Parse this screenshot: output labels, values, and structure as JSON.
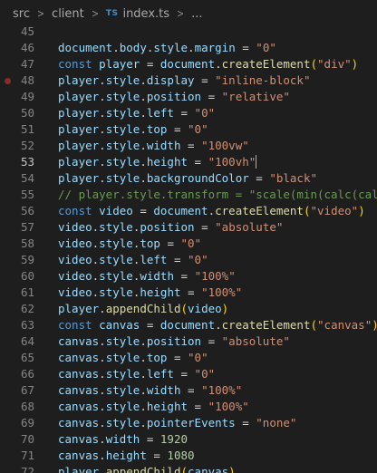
{
  "breadcrumb": {
    "items": [
      "src",
      "client",
      "index.ts",
      "..."
    ],
    "ts_badge": "TS"
  },
  "editor": {
    "language": "typescript",
    "current_line": 53,
    "breakpoint_lines": [
      48
    ],
    "lines": [
      {
        "n": 45,
        "tokens": []
      },
      {
        "n": 46,
        "tokens": [
          [
            "t-var",
            "document"
          ],
          [
            "t-op",
            "."
          ],
          [
            "t-var",
            "body"
          ],
          [
            "t-op",
            "."
          ],
          [
            "t-var",
            "style"
          ],
          [
            "t-op",
            "."
          ],
          [
            "t-var",
            "margin"
          ],
          [
            "t-op",
            " = "
          ],
          [
            "t-str",
            "\"0\""
          ]
        ]
      },
      {
        "n": 47,
        "tokens": [
          [
            "t-kw",
            "const "
          ],
          [
            "t-var",
            "player"
          ],
          [
            "t-op",
            " = "
          ],
          [
            "t-var",
            "document"
          ],
          [
            "t-op",
            "."
          ],
          [
            "t-fn",
            "createElement"
          ],
          [
            "t-p1",
            "("
          ],
          [
            "t-str",
            "\"div\""
          ],
          [
            "t-p1",
            ")"
          ]
        ]
      },
      {
        "n": 48,
        "tokens": [
          [
            "t-var",
            "player"
          ],
          [
            "t-op",
            "."
          ],
          [
            "t-var",
            "style"
          ],
          [
            "t-op",
            "."
          ],
          [
            "t-var",
            "display"
          ],
          [
            "t-op",
            " = "
          ],
          [
            "t-str",
            "\"inline-block\""
          ]
        ]
      },
      {
        "n": 49,
        "tokens": [
          [
            "t-var",
            "player"
          ],
          [
            "t-op",
            "."
          ],
          [
            "t-var",
            "style"
          ],
          [
            "t-op",
            "."
          ],
          [
            "t-var",
            "position"
          ],
          [
            "t-op",
            " = "
          ],
          [
            "t-str",
            "\"relative\""
          ]
        ]
      },
      {
        "n": 50,
        "tokens": [
          [
            "t-var",
            "player"
          ],
          [
            "t-op",
            "."
          ],
          [
            "t-var",
            "style"
          ],
          [
            "t-op",
            "."
          ],
          [
            "t-var",
            "left"
          ],
          [
            "t-op",
            " = "
          ],
          [
            "t-str",
            "\"0\""
          ]
        ]
      },
      {
        "n": 51,
        "tokens": [
          [
            "t-var",
            "player"
          ],
          [
            "t-op",
            "."
          ],
          [
            "t-var",
            "style"
          ],
          [
            "t-op",
            "."
          ],
          [
            "t-var",
            "top"
          ],
          [
            "t-op",
            " = "
          ],
          [
            "t-str",
            "\"0\""
          ]
        ]
      },
      {
        "n": 52,
        "tokens": [
          [
            "t-var",
            "player"
          ],
          [
            "t-op",
            "."
          ],
          [
            "t-var",
            "style"
          ],
          [
            "t-op",
            "."
          ],
          [
            "t-var",
            "width"
          ],
          [
            "t-op",
            " = "
          ],
          [
            "t-str",
            "\"100vw\""
          ]
        ]
      },
      {
        "n": 53,
        "tokens": [
          [
            "t-var",
            "player"
          ],
          [
            "t-op",
            "."
          ],
          [
            "t-var",
            "style"
          ],
          [
            "t-op",
            "."
          ],
          [
            "t-var",
            "height"
          ],
          [
            "t-op",
            " = "
          ],
          [
            "t-str",
            "\"100vh\""
          ]
        ],
        "cursor": true
      },
      {
        "n": 54,
        "tokens": [
          [
            "t-var",
            "player"
          ],
          [
            "t-op",
            "."
          ],
          [
            "t-var",
            "style"
          ],
          [
            "t-op",
            "."
          ],
          [
            "t-var",
            "backgroundColor"
          ],
          [
            "t-op",
            " = "
          ],
          [
            "t-str",
            "\"black\""
          ]
        ]
      },
      {
        "n": 55,
        "tokens": [
          [
            "t-com",
            "// player.style.transform = \"scale(min(calc(calc("
          ]
        ]
      },
      {
        "n": 56,
        "tokens": [
          [
            "t-kw",
            "const "
          ],
          [
            "t-var",
            "video"
          ],
          [
            "t-op",
            " = "
          ],
          [
            "t-var",
            "document"
          ],
          [
            "t-op",
            "."
          ],
          [
            "t-fn",
            "createElement"
          ],
          [
            "t-p1",
            "("
          ],
          [
            "t-str",
            "\"video\""
          ],
          [
            "t-p1",
            ")"
          ]
        ]
      },
      {
        "n": 57,
        "tokens": [
          [
            "t-var",
            "video"
          ],
          [
            "t-op",
            "."
          ],
          [
            "t-var",
            "style"
          ],
          [
            "t-op",
            "."
          ],
          [
            "t-var",
            "position"
          ],
          [
            "t-op",
            " = "
          ],
          [
            "t-str",
            "\"absolute\""
          ]
        ]
      },
      {
        "n": 58,
        "tokens": [
          [
            "t-var",
            "video"
          ],
          [
            "t-op",
            "."
          ],
          [
            "t-var",
            "style"
          ],
          [
            "t-op",
            "."
          ],
          [
            "t-var",
            "top"
          ],
          [
            "t-op",
            " = "
          ],
          [
            "t-str",
            "\"0\""
          ]
        ]
      },
      {
        "n": 59,
        "tokens": [
          [
            "t-var",
            "video"
          ],
          [
            "t-op",
            "."
          ],
          [
            "t-var",
            "style"
          ],
          [
            "t-op",
            "."
          ],
          [
            "t-var",
            "left"
          ],
          [
            "t-op",
            " = "
          ],
          [
            "t-str",
            "\"0\""
          ]
        ]
      },
      {
        "n": 60,
        "tokens": [
          [
            "t-var",
            "video"
          ],
          [
            "t-op",
            "."
          ],
          [
            "t-var",
            "style"
          ],
          [
            "t-op",
            "."
          ],
          [
            "t-var",
            "width"
          ],
          [
            "t-op",
            " = "
          ],
          [
            "t-str",
            "\"100%\""
          ]
        ]
      },
      {
        "n": 61,
        "tokens": [
          [
            "t-var",
            "video"
          ],
          [
            "t-op",
            "."
          ],
          [
            "t-var",
            "style"
          ],
          [
            "t-op",
            "."
          ],
          [
            "t-var",
            "height"
          ],
          [
            "t-op",
            " = "
          ],
          [
            "t-str",
            "\"100%\""
          ]
        ]
      },
      {
        "n": 62,
        "tokens": [
          [
            "t-var",
            "player"
          ],
          [
            "t-op",
            "."
          ],
          [
            "t-fn",
            "appendChild"
          ],
          [
            "t-p1",
            "("
          ],
          [
            "t-var",
            "video"
          ],
          [
            "t-p1",
            ")"
          ]
        ]
      },
      {
        "n": 63,
        "tokens": [
          [
            "t-kw",
            "const "
          ],
          [
            "t-var",
            "canvas"
          ],
          [
            "t-op",
            " = "
          ],
          [
            "t-var",
            "document"
          ],
          [
            "t-op",
            "."
          ],
          [
            "t-fn",
            "createElement"
          ],
          [
            "t-p1",
            "("
          ],
          [
            "t-str",
            "\"canvas\""
          ],
          [
            "t-p1",
            ")"
          ]
        ]
      },
      {
        "n": 64,
        "tokens": [
          [
            "t-var",
            "canvas"
          ],
          [
            "t-op",
            "."
          ],
          [
            "t-var",
            "style"
          ],
          [
            "t-op",
            "."
          ],
          [
            "t-var",
            "position"
          ],
          [
            "t-op",
            " = "
          ],
          [
            "t-str",
            "\"absolute\""
          ]
        ]
      },
      {
        "n": 65,
        "tokens": [
          [
            "t-var",
            "canvas"
          ],
          [
            "t-op",
            "."
          ],
          [
            "t-var",
            "style"
          ],
          [
            "t-op",
            "."
          ],
          [
            "t-var",
            "top"
          ],
          [
            "t-op",
            " = "
          ],
          [
            "t-str",
            "\"0\""
          ]
        ]
      },
      {
        "n": 66,
        "tokens": [
          [
            "t-var",
            "canvas"
          ],
          [
            "t-op",
            "."
          ],
          [
            "t-var",
            "style"
          ],
          [
            "t-op",
            "."
          ],
          [
            "t-var",
            "left"
          ],
          [
            "t-op",
            " = "
          ],
          [
            "t-str",
            "\"0\""
          ]
        ]
      },
      {
        "n": 67,
        "tokens": [
          [
            "t-var",
            "canvas"
          ],
          [
            "t-op",
            "."
          ],
          [
            "t-var",
            "style"
          ],
          [
            "t-op",
            "."
          ],
          [
            "t-var",
            "width"
          ],
          [
            "t-op",
            " = "
          ],
          [
            "t-str",
            "\"100%\""
          ]
        ]
      },
      {
        "n": 68,
        "tokens": [
          [
            "t-var",
            "canvas"
          ],
          [
            "t-op",
            "."
          ],
          [
            "t-var",
            "style"
          ],
          [
            "t-op",
            "."
          ],
          [
            "t-var",
            "height"
          ],
          [
            "t-op",
            " = "
          ],
          [
            "t-str",
            "\"100%\""
          ]
        ]
      },
      {
        "n": 69,
        "tokens": [
          [
            "t-var",
            "canvas"
          ],
          [
            "t-op",
            "."
          ],
          [
            "t-var",
            "style"
          ],
          [
            "t-op",
            "."
          ],
          [
            "t-var",
            "pointerEvents"
          ],
          [
            "t-op",
            " = "
          ],
          [
            "t-str",
            "\"none\""
          ]
        ]
      },
      {
        "n": 70,
        "tokens": [
          [
            "t-var",
            "canvas"
          ],
          [
            "t-op",
            "."
          ],
          [
            "t-var",
            "width"
          ],
          [
            "t-op",
            " = "
          ],
          [
            "t-num",
            "1920"
          ]
        ]
      },
      {
        "n": 71,
        "tokens": [
          [
            "t-var",
            "canvas"
          ],
          [
            "t-op",
            "."
          ],
          [
            "t-var",
            "height"
          ],
          [
            "t-op",
            " = "
          ],
          [
            "t-num",
            "1080"
          ]
        ]
      },
      {
        "n": 72,
        "tokens": [
          [
            "t-var",
            "player"
          ],
          [
            "t-op",
            "."
          ],
          [
            "t-fn",
            "appendChild"
          ],
          [
            "t-p1",
            "("
          ],
          [
            "t-var",
            "canvas"
          ],
          [
            "t-p1",
            ")"
          ]
        ]
      }
    ]
  },
  "colors": {
    "background": "#1e1e1e",
    "keyword": "#569cd6",
    "variable": "#9cdcfe",
    "function": "#dcdcaa",
    "string": "#ce9178",
    "number": "#b5cea8",
    "comment": "#6a9955",
    "breakpoint": "#8b2a2a"
  }
}
